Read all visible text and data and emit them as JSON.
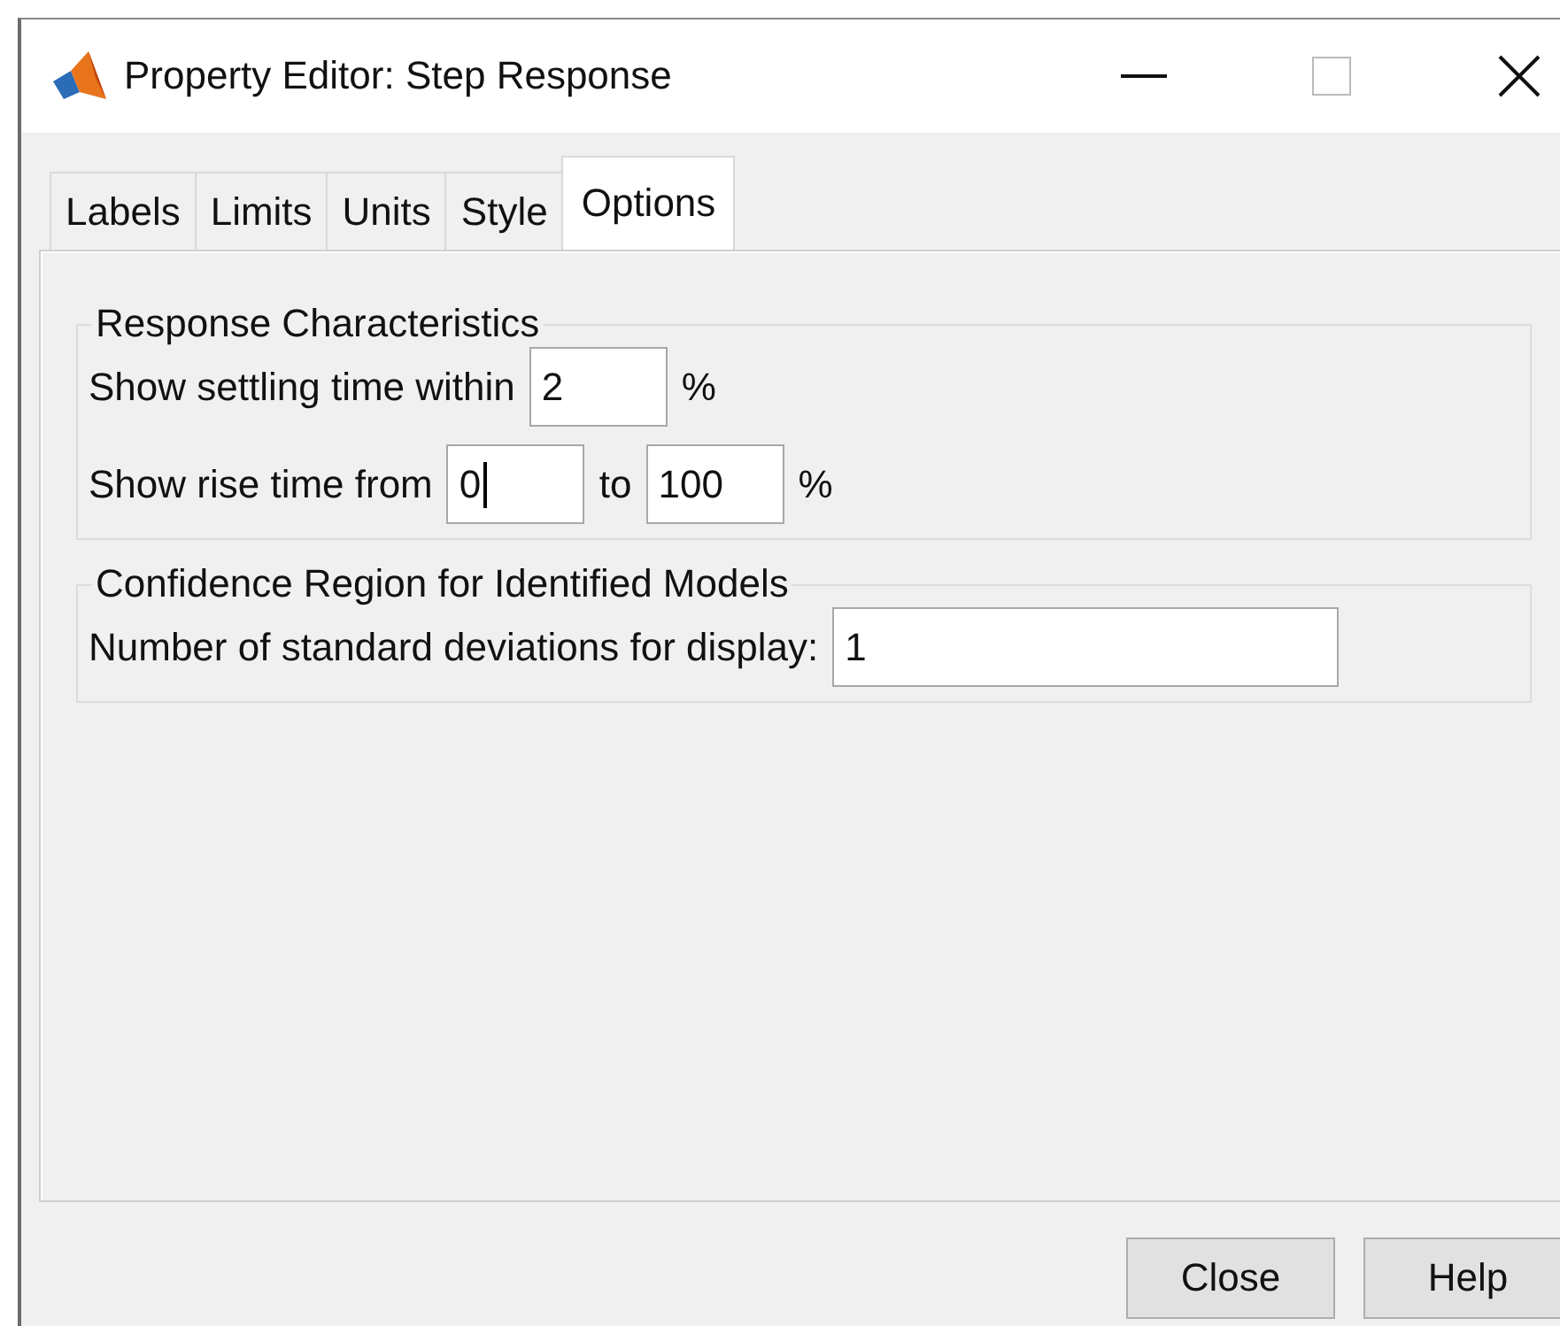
{
  "window": {
    "title": "Property Editor: Step Response"
  },
  "tabs": [
    {
      "label": "Labels",
      "selected": false
    },
    {
      "label": "Limits",
      "selected": false
    },
    {
      "label": "Units",
      "selected": false
    },
    {
      "label": "Style",
      "selected": false
    },
    {
      "label": "Options",
      "selected": true
    }
  ],
  "groups": [
    {
      "title": "Response Characteristics",
      "rows": [
        {
          "kind": "single",
          "label": "Show settling time within",
          "field": {
            "value": "2",
            "focused": false
          },
          "unit": "%"
        },
        {
          "kind": "range",
          "label": "Show rise time from",
          "field": {
            "value": "0",
            "focused": true
          },
          "to_label": "to",
          "to_field": {
            "value": "100",
            "focused": false
          },
          "unit": "%"
        }
      ]
    },
    {
      "title": "Confidence Region for Identified Models",
      "rows": [
        {
          "kind": "wide",
          "label": "Number of standard deviations for display:",
          "field": {
            "value": "1",
            "focused": false
          }
        }
      ]
    }
  ],
  "buttons": [
    "Close",
    "Help"
  ]
}
